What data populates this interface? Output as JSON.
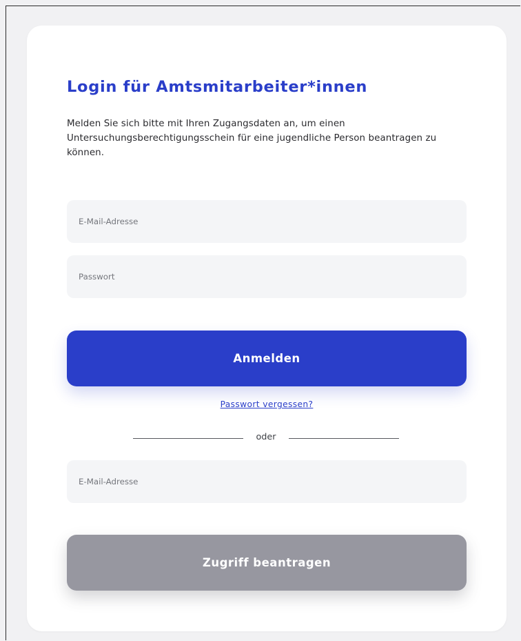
{
  "login": {
    "title": "Login für Amtsmitarbeiter*innen",
    "description": "Melden Sie sich bitte mit Ihren Zugangsdaten an, um einen Untersuchungsberechtigungsschein für eine jugendliche Person beantragen zu können.",
    "email_placeholder": "E-Mail-Adresse",
    "password_placeholder": "Passwort",
    "submit_label": "Anmelden",
    "forgot_password_label": "Passwort vergessen?"
  },
  "divider": {
    "label": "oder"
  },
  "request_access": {
    "email_placeholder": "E-Mail-Adresse",
    "submit_label": "Zugriff beantragen"
  },
  "colors": {
    "accent": "#2a3ec9",
    "secondary_button": "#9797a0",
    "field_background": "#f4f5f7",
    "page_background": "#f1f1f3",
    "card_background": "#ffffff"
  }
}
